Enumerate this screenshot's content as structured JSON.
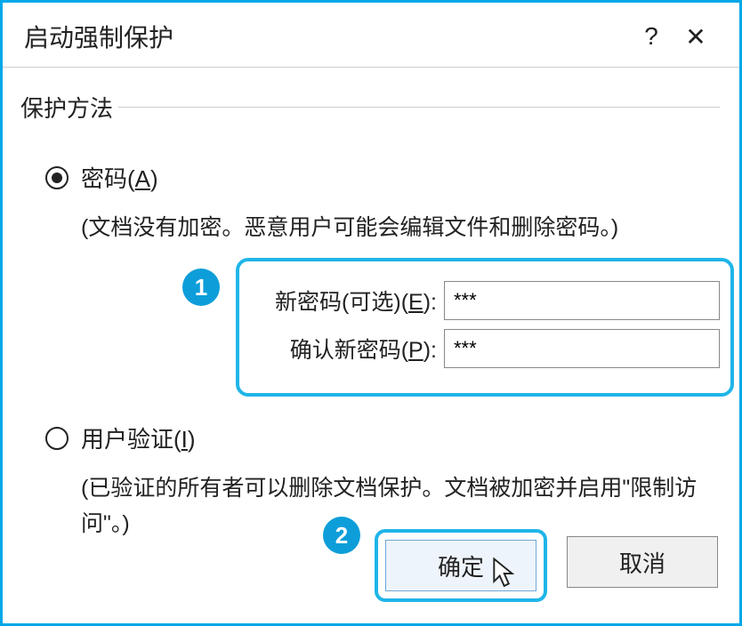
{
  "title": "启动强制保护",
  "icons": {
    "help": "?",
    "close": "✕"
  },
  "group_label": "保护方法",
  "options": {
    "password": {
      "label_pre": "密码(",
      "label_key": "A",
      "label_post": ")",
      "hint": "(文档没有加密。恶意用户可能会编辑文件和删除密码。)"
    },
    "userauth": {
      "label_pre": "用户验证(",
      "label_key": "I",
      "label_post": ")",
      "hint": "(已验证的所有者可以删除文档保护。文档被加密并启用\"限制访问\"。)"
    }
  },
  "password_fields": {
    "new_label_pre": "新密码(可选)(",
    "new_label_key": "E",
    "new_label_post": "):",
    "new_value": "***",
    "confirm_label_pre": "确认新密码(",
    "confirm_label_key": "P",
    "confirm_label_post": "):",
    "confirm_value": "***"
  },
  "callouts": {
    "one": "1",
    "two": "2"
  },
  "buttons": {
    "ok": "确定",
    "cancel": "取消"
  }
}
